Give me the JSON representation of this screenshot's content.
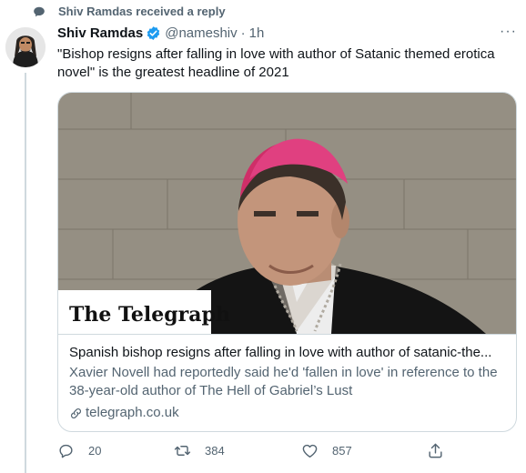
{
  "social_context": {
    "text": "Shiv Ramdas received a reply",
    "icon": "speech-bubble-icon"
  },
  "tweet": {
    "author_name": "Shiv Ramdas",
    "handle": "@nameshiv",
    "separator": "·",
    "time": "1h",
    "text": "\"Bishop resigns after falling in love with author of Satanic themed erotica novel\" is the greatest headline of 2021",
    "more_label": "···"
  },
  "card": {
    "image_logo": "The Telegraph",
    "title": "Spanish bishop resigns after falling in love with author of satanic-the...",
    "description": "Xavier Novell had reportedly said he'd 'fallen in love' in reference to the 38-year-old author of The Hell of Gabriel’s Lust",
    "domain": "telegraph.co.uk"
  },
  "actions": {
    "reply_count": "20",
    "retweet_count": "384",
    "like_count": "857"
  },
  "colors": {
    "verified": "#1d9bf0",
    "secondary_text": "#536471",
    "zucchetto": "#e0306e"
  }
}
